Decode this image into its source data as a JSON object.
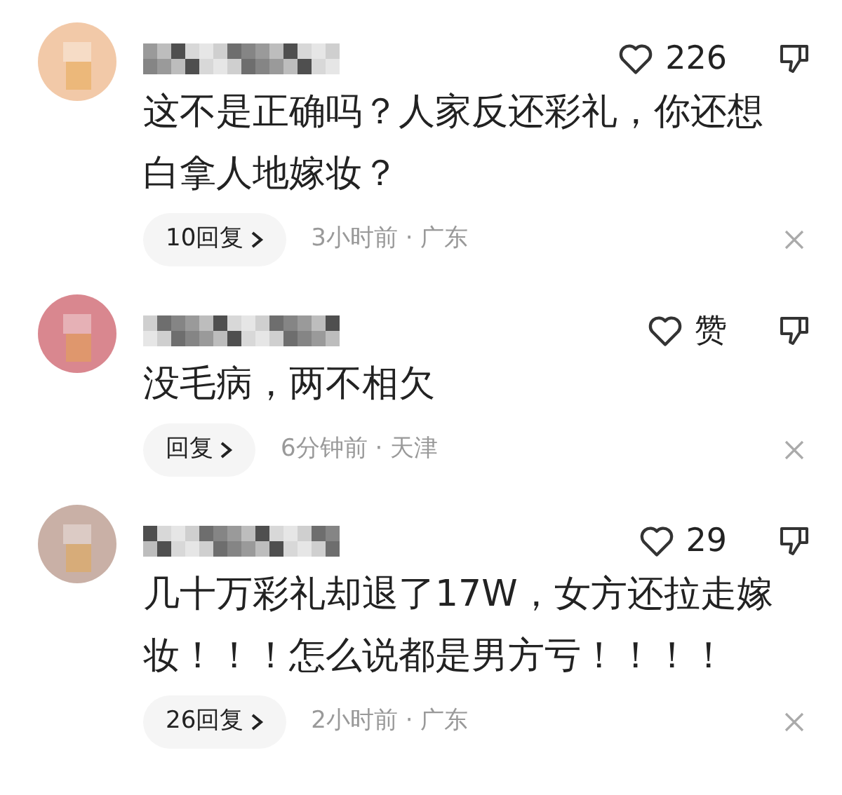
{
  "comments": [
    {
      "color": "#f2c9a8",
      "likes": "226",
      "text": "这不是正确吗？人家反还彩礼，你还想白拿人地嫁妆？",
      "replies": "10回复",
      "meta": "3小时前 · 广东"
    },
    {
      "color": "#d9878f",
      "likes": "赞",
      "text": "没毛病，两不相欠",
      "replies": "回复",
      "meta": "6分钟前 · 天津"
    },
    {
      "color": "#c9b0a6",
      "likes": "29",
      "text": "几十万彩礼却退了17W，女方还拉走嫁妆！！！怎么说都是男方亏！！！！",
      "replies": "26回复",
      "meta": "2小时前 · 广东"
    }
  ]
}
